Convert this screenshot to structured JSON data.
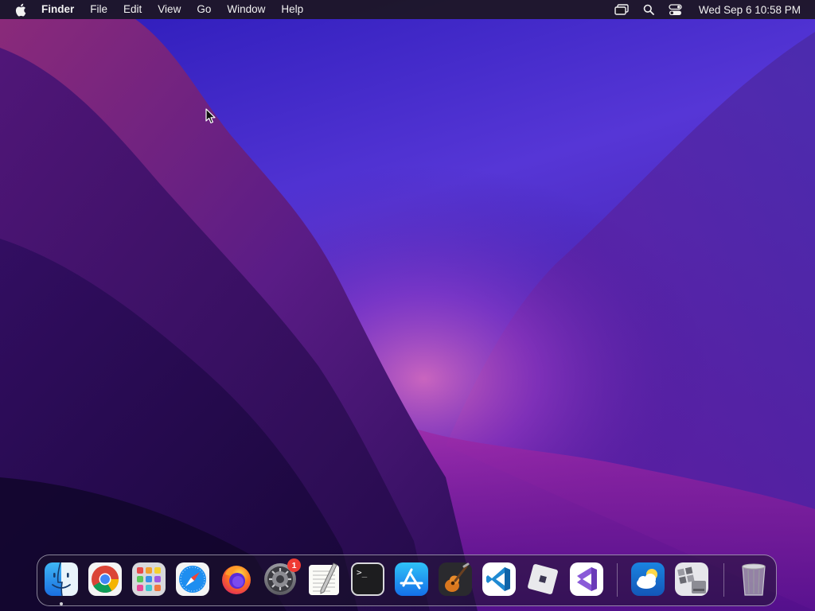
{
  "menubar": {
    "app_name": "Finder",
    "menus": [
      "File",
      "Edit",
      "View",
      "Go",
      "Window",
      "Help"
    ],
    "status_icons": [
      "screen-mirroring-icon",
      "search-icon",
      "control-center-icon"
    ],
    "clock": "Wed Sep 6  10:58 PM"
  },
  "dock": {
    "apps": [
      {
        "name": "Finder",
        "icon": "finder-icon",
        "running": true
      },
      {
        "name": "Google Chrome",
        "icon": "chrome-icon"
      },
      {
        "name": "Launchpad",
        "icon": "launchpad-icon"
      },
      {
        "name": "Safari",
        "icon": "safari-icon"
      },
      {
        "name": "Firefox",
        "icon": "firefox-icon"
      },
      {
        "name": "System Settings",
        "icon": "system-settings-icon",
        "badge": "1"
      },
      {
        "name": "TextEdit",
        "icon": "textedit-icon"
      },
      {
        "name": "Terminal",
        "icon": "terminal-icon",
        "glyph": ">_"
      },
      {
        "name": "App Store",
        "icon": "app-store-icon"
      },
      {
        "name": "GarageBand",
        "icon": "garageband-icon"
      },
      {
        "name": "Visual Studio Code",
        "icon": "vscode-icon"
      },
      {
        "name": "Roblox",
        "icon": "roblox-icon"
      },
      {
        "name": "Visual Studio",
        "icon": "visual-studio-icon"
      }
    ],
    "others": [
      {
        "name": "Weather",
        "icon": "weather-icon"
      },
      {
        "name": "Boot Camp Assistant",
        "icon": "boot-camp-icon"
      }
    ],
    "trash": {
      "name": "Trash",
      "icon": "trash-icon"
    }
  },
  "colors": {
    "menubar_bg": "#1c1622",
    "wallpaper_top": "#3b24c9",
    "wallpaper_ridge": "#b13a8a",
    "badge_red": "#ef3b34"
  }
}
